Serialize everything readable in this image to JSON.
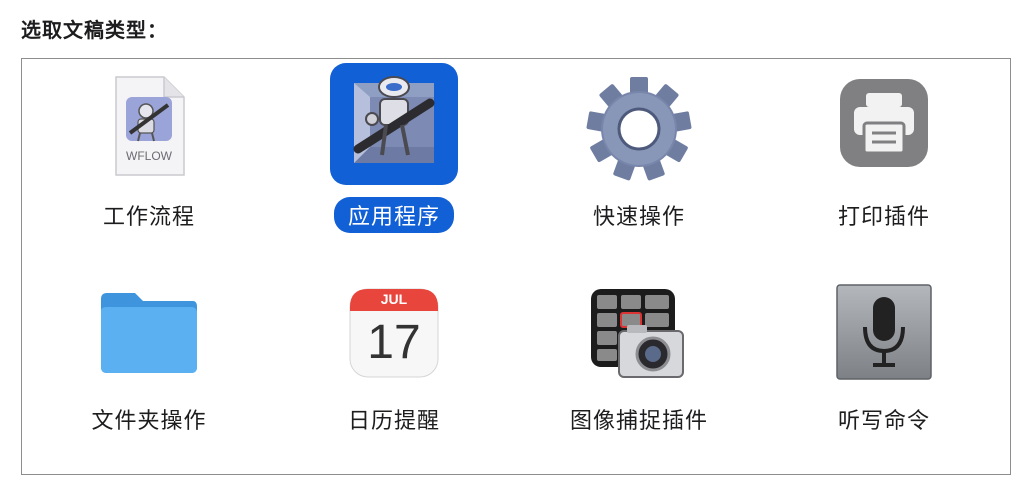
{
  "heading": "选取文稿类型：",
  "items": [
    {
      "label": "工作流程",
      "icon": "workflow-document-icon",
      "badge_text": "WFLOW",
      "selected": false
    },
    {
      "label": "应用程序",
      "icon": "automator-robot-icon",
      "selected": true
    },
    {
      "label": "快速操作",
      "icon": "gear-icon",
      "selected": false
    },
    {
      "label": "打印插件",
      "icon": "printer-icon",
      "selected": false
    },
    {
      "label": "文件夹操作",
      "icon": "folder-icon",
      "selected": false
    },
    {
      "label": "日历提醒",
      "icon": "calendar-icon",
      "calendar_month": "JUL",
      "calendar_day": "17",
      "selected": false
    },
    {
      "label": "图像捕捉插件",
      "icon": "image-capture-icon",
      "selected": false
    },
    {
      "label": "听写命令",
      "icon": "microphone-icon",
      "selected": false
    }
  ],
  "colors": {
    "selection": "#1260d6",
    "folder": "#5ab0f0",
    "calendar_red": "#e8453c"
  }
}
